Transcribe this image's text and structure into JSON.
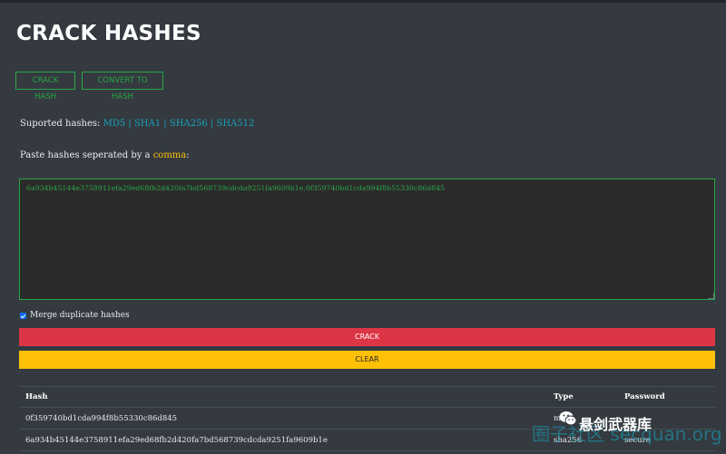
{
  "header": {
    "title": "CRACK HASHES"
  },
  "tabs": [
    {
      "label": "CRACK HASH"
    },
    {
      "label": "CONVERT TO HASH"
    }
  ],
  "supported": {
    "label": "Suported hashes:",
    "hashes": [
      "MD5",
      "SHA1",
      "SHA256",
      "SHA512"
    ],
    "separator": " | "
  },
  "paste": {
    "prefix": "Paste hashes seperated by a ",
    "highlight": "comma",
    "suffix": ":"
  },
  "input": {
    "value": "6a934b45144e3758911efa29ed68fb2d420fa7bd568739cdcda9251fa9609b1e,0f359740bd1cda994f8b55330c86d845"
  },
  "merge": {
    "label": "Merge duplicate hashes",
    "checked": true
  },
  "buttons": {
    "crack": "CRACK",
    "clear": "CLEAR"
  },
  "results": {
    "columns": [
      "Hash",
      "Type",
      "Password"
    ],
    "rows": [
      {
        "hash": "0f359740bd1cda994f8b55330c86d845",
        "type": "md5",
        "password": ""
      },
      {
        "hash": "6a934b45144e3758911efa29ed68fb2d420fa7bd568739cdcda9251fa9609b1e",
        "type": "sha256",
        "password": "secure"
      }
    ]
  },
  "watermark": {
    "back": "圈子社区 secquan.org",
    "front": "悬剑武器库",
    "icon": "wechat-icon"
  },
  "colors": {
    "background": "#343a40",
    "success": "#28a745",
    "info": "#17a2b8",
    "warning": "#ffc107",
    "danger": "#dc3545"
  }
}
